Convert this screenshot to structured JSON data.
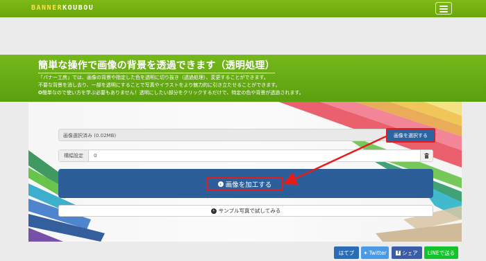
{
  "navbar": {
    "logo_part1": "BANNER",
    "logo_part2": "KOUBOU"
  },
  "hero": {
    "title": "簡単な操作で画像の背景を透過できます（透明処理）",
    "lines": [
      "「バナー工房」では、画像の背景や指定した色を透明に切り抜き（透過処理）、変更することができます。",
      "不要な背景を消し去り、一部を透明にすることで写真やイラストをより魅力的に引き立たせることができます。",
      "✪簡単なので使い方を学ぶ必要もありません！透明にしたい部分をクリックするだけで、特定の色や背景が透過されます。"
    ]
  },
  "form": {
    "file_status": "画像選択済み (0.02MB)",
    "select_button": "画像を選択する",
    "margin_label": "構幅設定",
    "margin_value": "0",
    "process_button": "画像を加工する",
    "sample_button": "サンプル写真で試してみる"
  },
  "share": {
    "hatena": "はてブ",
    "twitter": "Twitter",
    "facebook": "シェア",
    "line": "LINEで送る"
  },
  "colors": {
    "nav_green": "#6aa70b",
    "hero_green": "#5aa00f",
    "primary_blue": "#2c5f99",
    "highlight_red": "#e51c1c",
    "logo_yellow": "#ffe14a"
  }
}
